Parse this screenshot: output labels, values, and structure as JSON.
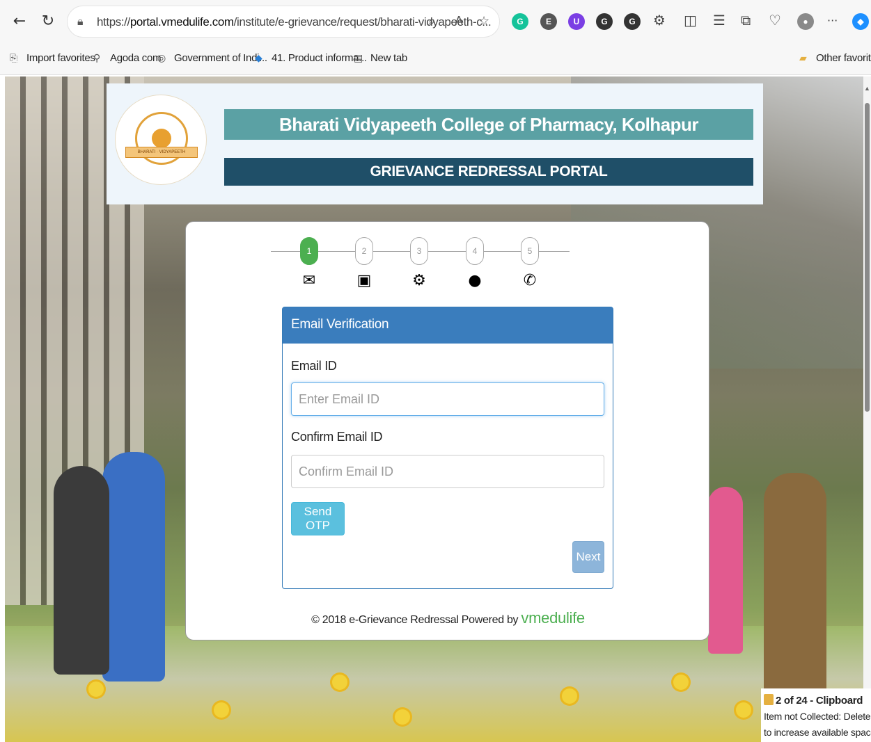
{
  "browser": {
    "url_prefix": "https://",
    "url_domain": "portal.vmedulife.com",
    "url_path": "/institute/e-grievance/request/bharati-vidyapeeth-c...",
    "favorites": [
      {
        "label": "Import favorites",
        "icon": "import-icon"
      },
      {
        "label": "Agoda com",
        "icon": "agoda-icon"
      },
      {
        "label": "Government of Indi...",
        "icon": "gov-emblem-icon"
      },
      {
        "label": "41. Product informa...",
        "icon": "diamond-icon"
      },
      {
        "label": "New tab",
        "icon": "page-icon"
      }
    ],
    "other_favorites": "Other favorites",
    "more": "···"
  },
  "header": {
    "college_name": "Bharati Vidyapeeth College of Pharmacy, Kolhapur",
    "portal_name": "GRIEVANCE REDRESSAL PORTAL",
    "logo_text_left": "BHARATI",
    "logo_text_right": "VIDYAPEETH"
  },
  "steps": [
    {
      "number": "1",
      "icon": "envelope-icon",
      "active": true
    },
    {
      "number": "2",
      "icon": "contact-card-icon",
      "active": false
    },
    {
      "number": "3",
      "icon": "cogs-icon",
      "active": false
    },
    {
      "number": "4",
      "icon": "comment-icon",
      "active": false
    },
    {
      "number": "5",
      "icon": "phone-icon",
      "active": false
    }
  ],
  "form": {
    "title": "Email Verification",
    "email_label": "Email ID",
    "email_placeholder": "Enter Email ID",
    "confirm_label": "Confirm Email ID",
    "confirm_placeholder": "Confirm Email ID",
    "send_otp": "Send OTP",
    "next": "Next"
  },
  "footer": {
    "text": "© 2018 e-Grievance Redressal Powered by ",
    "brand": "vmedulife"
  },
  "toast": {
    "title": "2 of 24 - Clipboard",
    "line1": "Item not Collected: Delete items",
    "line2": "to increase available space"
  },
  "colors": {
    "title_bar": "#5ba1a4",
    "subtitle_bar": "#1f4f68",
    "panel_header": "#3a7dbd",
    "step_active": "#4caf50",
    "otp_button": "#5bc0de",
    "next_button": "#8db5da"
  }
}
